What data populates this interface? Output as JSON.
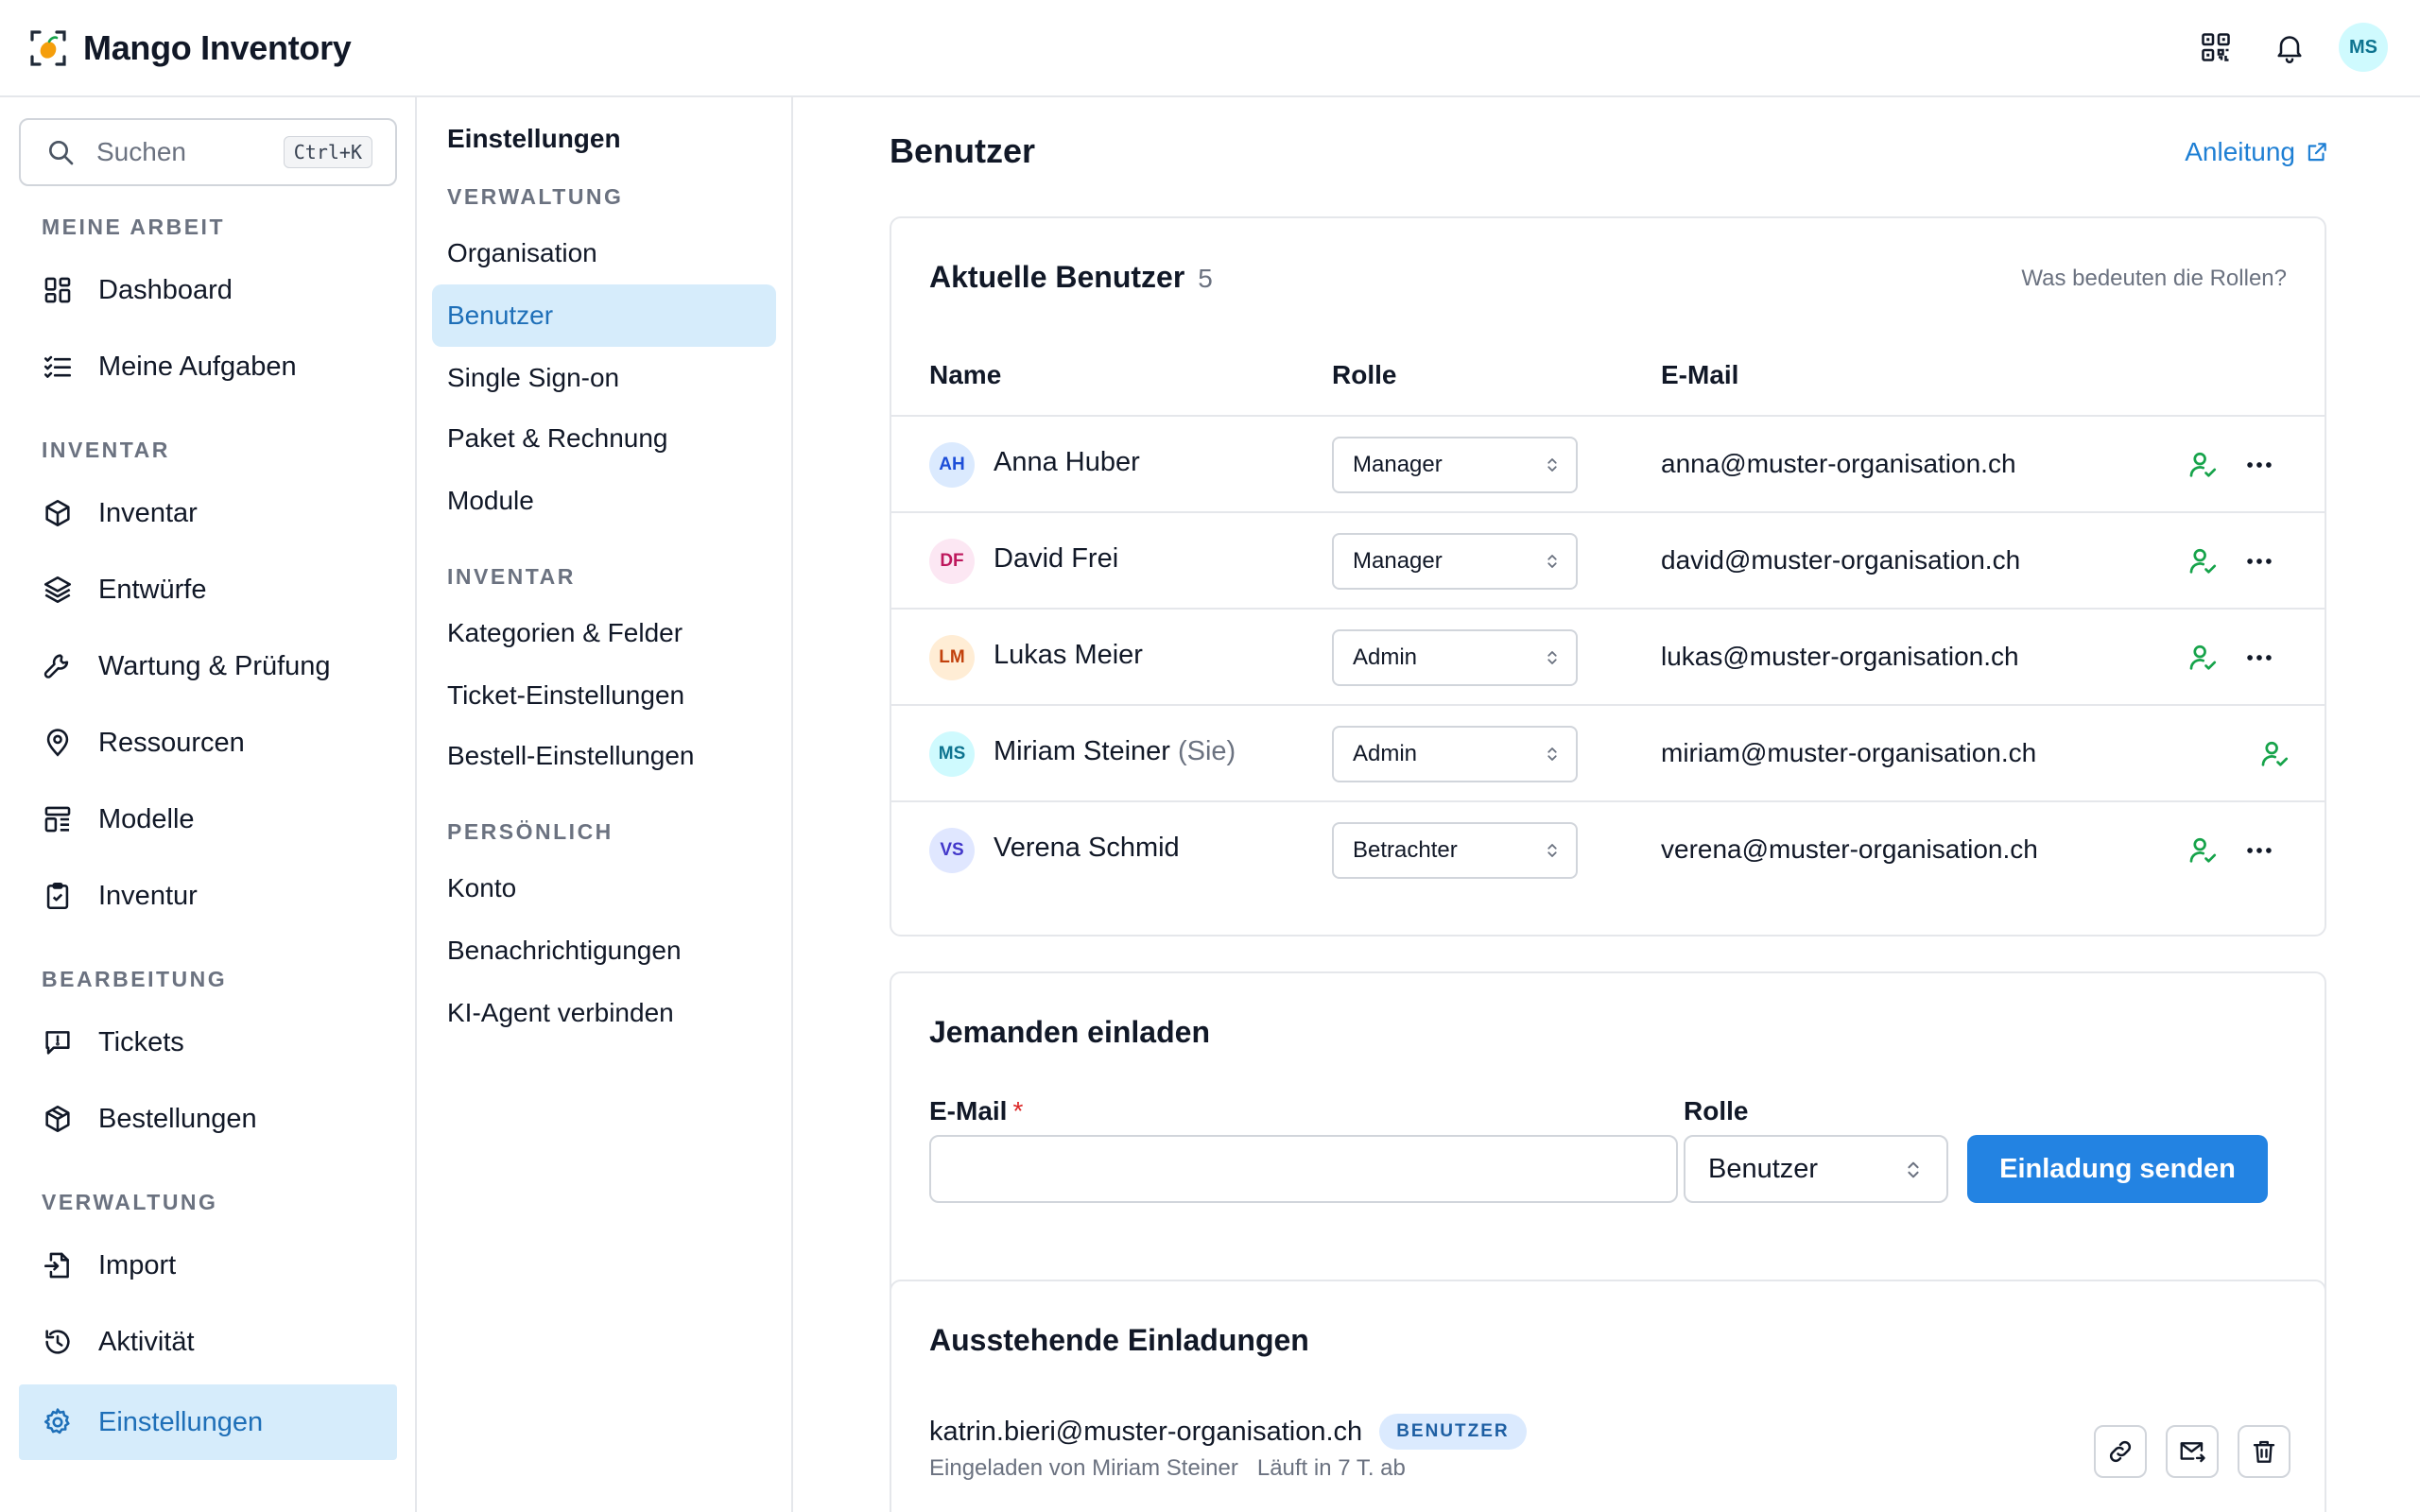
{
  "app": {
    "name": "Mango Inventory",
    "user_initials": "MS"
  },
  "sidebar": {
    "search_placeholder": "Suchen",
    "search_shortcut": "Ctrl+K",
    "sections": {
      "my_work": "MEINE ARBEIT",
      "inventory": "INVENTAR",
      "editing": "BEARBEITUNG",
      "admin": "VERWALTUNG"
    },
    "items": {
      "dashboard": "Dashboard",
      "tasks": "Meine Aufgaben",
      "inventory": "Inventar",
      "drafts": "Entwürfe",
      "maintenance": "Wartung & Prüfung",
      "resources": "Ressourcen",
      "models": "Modelle",
      "stocktake": "Inventur",
      "tickets": "Tickets",
      "orders": "Bestellungen",
      "import": "Import",
      "activity": "Aktivität",
      "settings": "Einstellungen"
    }
  },
  "settings_nav": {
    "title": "Einstellungen",
    "sections": {
      "admin": "VERWALTUNG",
      "inventory": "INVENTAR",
      "personal": "PERSÖNLICH"
    },
    "items": {
      "organisation": "Organisation",
      "users": "Benutzer",
      "sso": "Single Sign-on",
      "billing": "Paket & Rechnung",
      "modules": "Module",
      "categories": "Kategorien & Felder",
      "ticket_settings": "Ticket-Einstellungen",
      "order_settings": "Bestell-Einstellungen",
      "account": "Konto",
      "notifications": "Benachrichtigungen",
      "ai_agent": "KI-Agent verbinden"
    }
  },
  "main": {
    "title": "Benutzer",
    "guide_link": "Anleitung",
    "users_card": {
      "title": "Aktuelle Benutzer",
      "count": "5",
      "roles_help": "Was bedeuten die Rollen?",
      "headers": {
        "name": "Name",
        "role": "Rolle",
        "email": "E-Mail"
      },
      "rows": [
        {
          "initials": "AH",
          "name": "Anna Huber",
          "you": "",
          "role": "Manager",
          "email": "anna@muster-organisation.ch"
        },
        {
          "initials": "DF",
          "name": "David Frei",
          "you": "",
          "role": "Manager",
          "email": "david@muster-organisation.ch"
        },
        {
          "initials": "LM",
          "name": "Lukas Meier",
          "you": "",
          "role": "Admin",
          "email": "lukas@muster-organisation.ch"
        },
        {
          "initials": "MS",
          "name": "Miriam Steiner",
          "you": "(Sie)",
          "role": "Admin",
          "email": "miriam@muster-organisation.ch"
        },
        {
          "initials": "VS",
          "name": "Verena Schmid",
          "you": "",
          "role": "Betrachter",
          "email": "verena@muster-organisation.ch"
        }
      ]
    },
    "invite_card": {
      "title": "Jemanden einladen",
      "email_label": "E-Mail",
      "required_mark": "*",
      "email_value": "",
      "role_label": "Rolle",
      "role_value": "Benutzer",
      "send_button": "Einladung senden"
    },
    "pending_card": {
      "title": "Ausstehende Einladungen",
      "invites": [
        {
          "email": "katrin.bieri@muster-organisation.ch",
          "role_badge": "BENUTZER",
          "invited_by": "Eingeladen von Miriam Steiner",
          "expires": "Läuft in 7 T. ab"
        }
      ]
    }
  },
  "colors": {
    "accent": "#2383e2",
    "active_bg": "#d6ecfb",
    "active_text": "#1e6fb8",
    "user_icon": "#16a34a",
    "avatar_ah_bg": "#dbeafe",
    "avatar_ah_fg": "#1d4ed8",
    "avatar_df_bg": "#fce7f3",
    "avatar_df_fg": "#be185d",
    "avatar_lm_bg": "#ffedd5",
    "avatar_lm_fg": "#c2410c",
    "avatar_ms_bg": "#cffafe",
    "avatar_ms_fg": "#0e7490",
    "avatar_vs_bg": "#e0e7ff",
    "avatar_vs_fg": "#4338ca"
  }
}
